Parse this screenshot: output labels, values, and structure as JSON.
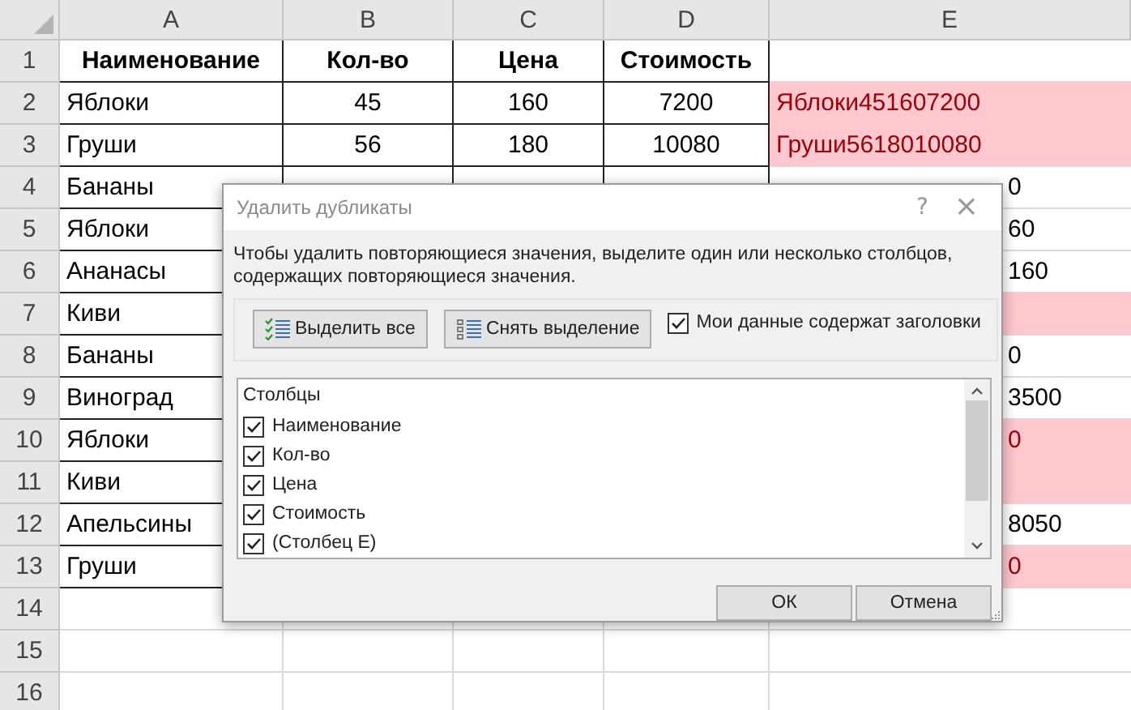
{
  "sheet": {
    "columns": [
      "A",
      "B",
      "C",
      "D",
      "E"
    ],
    "rows": [
      {
        "number": "1",
        "kind": "header",
        "a": "Наименование",
        "b": "Кол-во",
        "c": "Цена",
        "d": "Стоимость"
      },
      {
        "number": "2",
        "kind": "data",
        "a": "Яблоки",
        "b": "45",
        "c": "160",
        "d": "7200",
        "e": "Яблоки451607200",
        "duplicate": true
      },
      {
        "number": "3",
        "kind": "data",
        "a": "Груши",
        "b": "56",
        "c": "180",
        "d": "10080",
        "e": "Груши5618010080",
        "duplicate": true
      },
      {
        "number": "4",
        "kind": "covered",
        "a": "Бананы",
        "e": "0",
        "duplicate": false
      },
      {
        "number": "5",
        "kind": "covered",
        "a": "Яблоки",
        "e": "60",
        "duplicate": false
      },
      {
        "number": "6",
        "kind": "covered",
        "a": "Ананасы",
        "e": "160",
        "duplicate": false
      },
      {
        "number": "7",
        "kind": "covered",
        "a": "Киви",
        "duplicate": true
      },
      {
        "number": "8",
        "kind": "covered",
        "a": "Бананы",
        "e": "0",
        "duplicate": false
      },
      {
        "number": "9",
        "kind": "covered",
        "a": "Виноград",
        "e": "3500",
        "duplicate": false
      },
      {
        "number": "10",
        "kind": "covered",
        "a": "Яблоки",
        "e": "0",
        "duplicate": true
      },
      {
        "number": "11",
        "kind": "covered",
        "a": "Киви",
        "duplicate": true
      },
      {
        "number": "12",
        "kind": "covered",
        "a": "Апельсины",
        "e": "8050",
        "duplicate": false
      },
      {
        "number": "13",
        "kind": "covered",
        "a": "Груши",
        "e": "0",
        "duplicate": true
      },
      {
        "number": "14",
        "kind": "empty"
      },
      {
        "number": "15",
        "kind": "empty"
      },
      {
        "number": "16",
        "kind": "empty"
      }
    ]
  },
  "dialog": {
    "title": "Удалить дубликаты",
    "help": "?",
    "close": "×",
    "instructions": "Чтобы удалить повторяющиеся значения, выделите один или несколько столбцов, содержащих повторяющиеся значения.",
    "select_all": "Выделить все",
    "unselect_all": "Снять выделение",
    "headers_checkbox": {
      "label": "Мои данные содержат заголовки",
      "checked": true
    },
    "columns_list": {
      "heading": "Столбцы",
      "items": [
        {
          "label": "Наименование",
          "checked": true
        },
        {
          "label": "Кол-во",
          "checked": true
        },
        {
          "label": "Цена",
          "checked": true
        },
        {
          "label": "Стоимость",
          "checked": true
        },
        {
          "label": "(Столбец E)",
          "checked": true
        }
      ]
    },
    "buttons": [
      "ОК",
      "Отмена"
    ]
  }
}
